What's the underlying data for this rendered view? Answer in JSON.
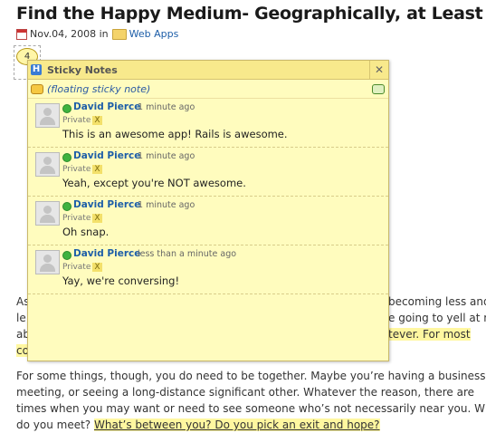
{
  "post": {
    "title": "Find the Happy Medium- Geographically, at Least",
    "date": "Nov.04, 2008",
    "in_label": "in",
    "category": "Web Apps"
  },
  "note_count": "4",
  "article": {
    "p1_line1_start": "As",
    "p1_line1_end": "becoming less and",
    "p1_line2_start": "le",
    "p1_line2_end": "e going to yell at m",
    "p1_line3_start": "ab",
    "p1_line3_hl": "tever. For most",
    "p1_line4_start": "co",
    "p2_line1": "For some things, though, you do need to be together. Maybe you’re having a business",
    "p2_line2": "meeting, or seeing a long-distance significant other. Whatever the reason, there are",
    "p2_line3": "times when you may want or need to see someone who’s not necessarily near you. Wher",
    "p2_line4_start": "do you meet?",
    "p2_line4_hl": "What’s between you? Do you pick an exit and hope?"
  },
  "panel": {
    "title": "Sticky Notes",
    "close": "✕",
    "floating_label": "(floating sticky note)",
    "notes": [
      {
        "author": "David Pierce",
        "time": "1 minute ago",
        "privacy": "Private",
        "x": "X",
        "text": "This is an awesome app! Rails is awesome."
      },
      {
        "author": "David Pierce",
        "time": "1 minute ago",
        "privacy": "Private",
        "x": "X",
        "text": "Yeah, except you're NOT awesome."
      },
      {
        "author": "David Pierce",
        "time": "1 minute ago",
        "privacy": "Private",
        "x": "X",
        "text": "Oh snap."
      },
      {
        "author": "David Pierce",
        "time": "less than a minute ago",
        "privacy": "Private",
        "x": "X",
        "text": "Yay, we're conversing!"
      }
    ]
  },
  "colors": {
    "panel_bg": "#fffcbe",
    "panel_header": "#f8e98c",
    "link_blue": "#1d5ea8",
    "highlight": "#fff7a0"
  },
  "icons": [
    "calendar-icon",
    "folder-icon",
    "sticky-notes-logo-icon",
    "close-icon",
    "speech-bubble-icon",
    "add-note-icon",
    "online-status-icon",
    "avatar-icon"
  ]
}
